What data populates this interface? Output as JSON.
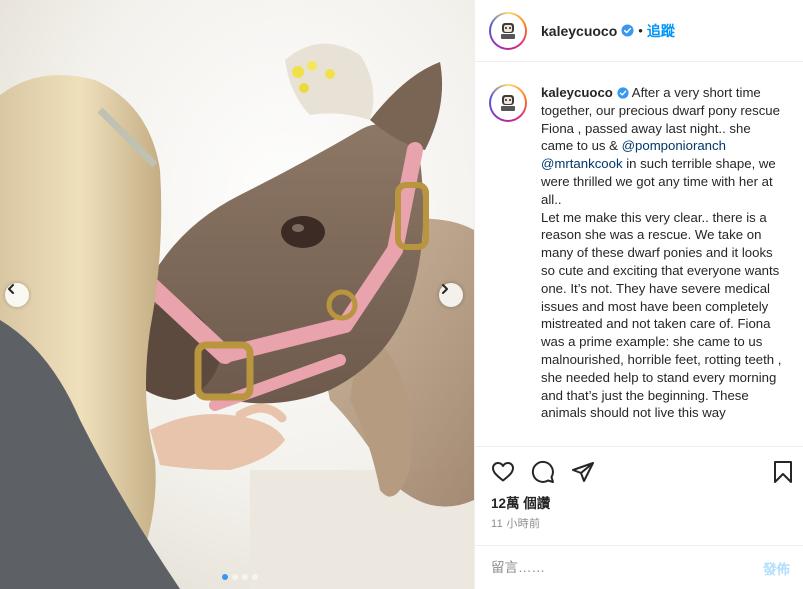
{
  "post": {
    "username": "kaleycuoco",
    "follow_label": "追蹤",
    "separator": "•",
    "caption_user": "kaleycuoco",
    "caption_part1": " After a very short time together, our precious dwarf pony rescue Fiona , passed away last night.. she came to us & ",
    "mention1": "@pomponioranch",
    "caption_part2": " ",
    "mention2": "@mrtankcook",
    "caption_part3": " in such terrible shape, we were thrilled we got any time with her at all..\nLet me make this very clear.. there is a reason she was a rescue. We take on many of these dwarf ponies and it looks so cute and exciting that everyone wants one. It’s not. They have severe medical issues and most have been completely mistreated and not taken care of. Fiona was a prime example: she came to us malnourished, horrible feet, rotting teeth , she needed help to stand every morning and that’s just the beginning. These animals should not live this way",
    "likes": "12萬 個讚",
    "time_ago": "11 小時前",
    "comment_placeholder": "留言……",
    "post_label": "發佈"
  },
  "carousel": {
    "total_slides": 4,
    "current_slide": 1
  },
  "icons": {
    "verified": "verified-badge-icon",
    "like": "heart-icon",
    "comment": "comment-bubble-icon",
    "share": "paper-plane-icon",
    "save": "bookmark-icon",
    "prev": "chevron-left-icon",
    "next": "chevron-right-icon"
  },
  "colors": {
    "accent": "#0095f6",
    "verified": "#3897f0",
    "text": "#262626",
    "muted": "#8e8e8e",
    "halter": "#e8a3ad"
  }
}
